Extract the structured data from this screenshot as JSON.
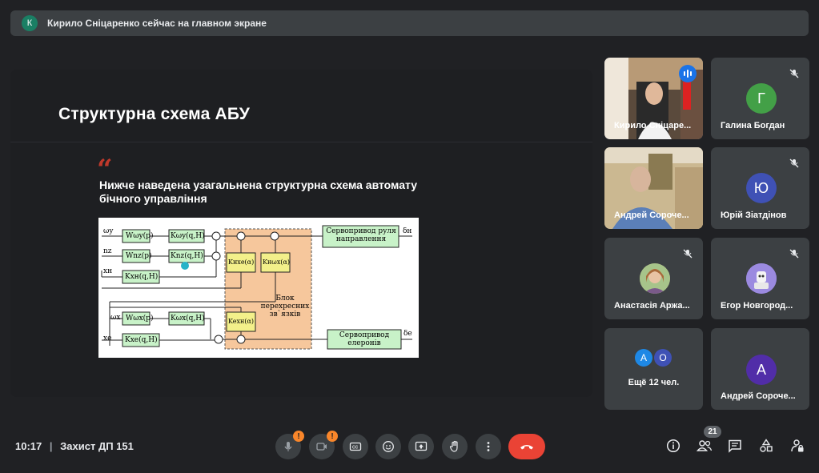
{
  "banner": {
    "avatar_letter": "К",
    "text": "Кирило Сніцаренко сейчас на главном экране"
  },
  "slide": {
    "title": "Структурна схема АБУ",
    "quote_mark": "“",
    "text": "Нижче наведена узагальнена структурна схема автомату бічного управління",
    "diagram": {
      "inputs": [
        "ωy",
        "nz",
        "xн",
        "ωx",
        "xе"
      ],
      "blocks": {
        "w_omega_y": "Wωy(p)",
        "k_omega_y": "Kωy(q,H)",
        "w_nz": "Wnz(p)",
        "k_nz": "Knz(q,H)",
        "k_xh": "Kxн(q,H)",
        "w_omega_x": "Wωx(p)",
        "k_omega_x": "Kωx(q,H)",
        "k_xe": "Kxe(q,H)",
        "cross_1": "Kнxe(α)",
        "cross_2": "Kнωx(α)",
        "cross_3": "Keхн(α)"
      },
      "cross_block_label": "Блок перехресних зв`язків",
      "servo_rudder": "Сервопривод руля направлення",
      "servo_aileron": "Сервопривод елеронів",
      "outputs": [
        "δн",
        "δе"
      ]
    }
  },
  "participants": [
    {
      "name": "Кирило Сніцаренко",
      "display": "Кирило Сніцаре...",
      "type": "video",
      "speaking": true
    },
    {
      "name": "Галина Богдан",
      "letter": "Г",
      "color": "#43a047",
      "muted": true
    },
    {
      "name": "Андрей Сорочен",
      "display": "Андрей Сороче...",
      "type": "video",
      "muted": false
    },
    {
      "name": "Юрій Зіатдінов",
      "letter": "Ю",
      "color": "#3f51b5",
      "muted": true
    },
    {
      "name": "Анастасія Аржа",
      "display": "Анастасія Аржа...",
      "type": "photo",
      "muted": true
    },
    {
      "name": "Егор Новгород",
      "display": "Егор Новгород...",
      "type": "photo",
      "muted": true
    },
    {
      "name": "Ещё 12 чел.",
      "letters": [
        "А",
        "О"
      ],
      "colors": [
        "#1e88e5",
        "#3f51b5"
      ]
    },
    {
      "name": "Андрей Сороче",
      "display": "Андрей Сороче...",
      "letter": "А",
      "color": "#512da8"
    }
  ],
  "bottom_bar": {
    "time": "10:17",
    "separator": "|",
    "meeting": "Захист ДП 151",
    "mic_badge": "!",
    "cam_badge": "!",
    "people_count": "21",
    "accent_end_call": "#ea4335"
  }
}
